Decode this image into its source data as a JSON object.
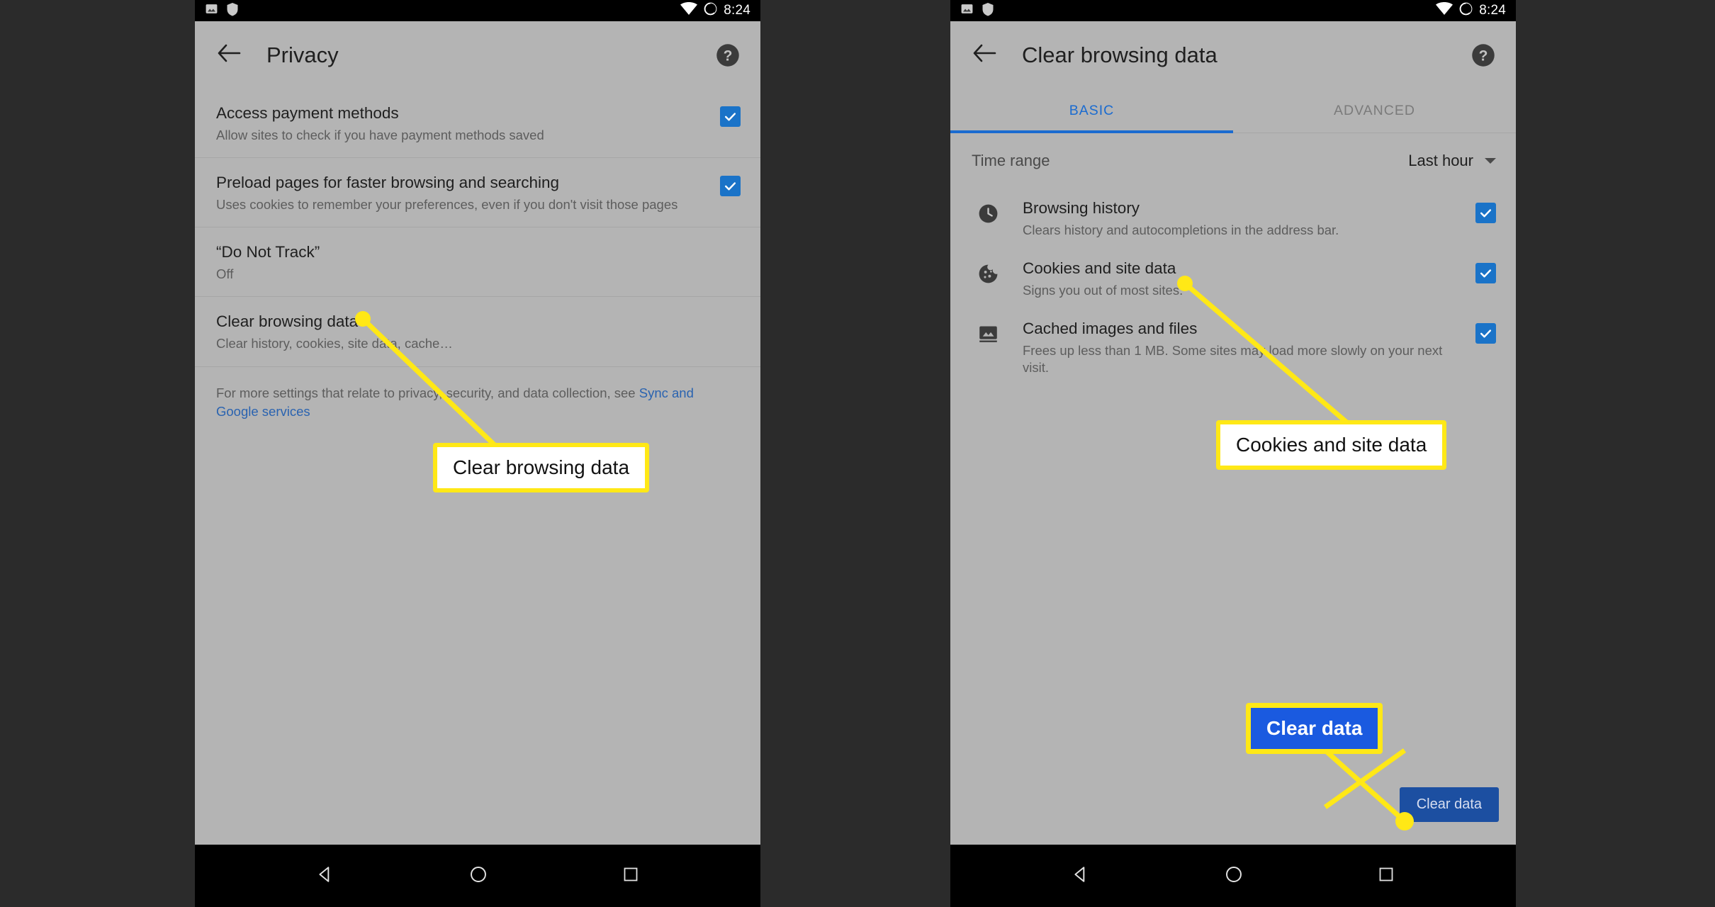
{
  "status_bar": {
    "time": "8:24",
    "icons_left": [
      "image-icon",
      "shield-icon"
    ],
    "icons_right": [
      "wifi-icon",
      "battery-icon"
    ]
  },
  "nav_bar": {
    "back": "back-triangle-icon",
    "home": "home-circle-icon",
    "recents": "recents-square-icon"
  },
  "colors": {
    "accent_blue": "#1a73c8",
    "link_blue": "#2a63b0",
    "tab_blue": "#1a6bd0",
    "highlight_yellow": "#ffe816",
    "button_blue": "#1c4fa1",
    "screen_bg": "#b4b4b4"
  },
  "left_phone": {
    "appbar": {
      "back_icon": "arrow-back-icon",
      "title": "Privacy",
      "help_icon": "help-icon"
    },
    "rows": [
      {
        "title": "Access payment methods",
        "sub": "Allow sites to check if you have payment methods saved",
        "checked": true
      },
      {
        "title": "Preload pages for faster browsing and searching",
        "sub": "Uses cookies to remember your preferences, even if you don't visit those pages",
        "checked": true
      },
      {
        "title": "“Do Not Track”",
        "sub": "Off",
        "checked": false
      },
      {
        "title": "Clear browsing data",
        "sub": "Clear history, cookies, site data, cache…",
        "checked": false
      }
    ],
    "footnote": {
      "text": "For more settings that relate to privacy, security, and data collection, see ",
      "link": "Sync and Google services"
    }
  },
  "right_phone": {
    "appbar": {
      "back_icon": "arrow-back-icon",
      "title": "Clear browsing data",
      "help_icon": "help-icon"
    },
    "tabs": [
      {
        "label": "BASIC",
        "active": true
      },
      {
        "label": "ADVANCED",
        "active": false
      }
    ],
    "time_range": {
      "label": "Time range",
      "value": "Last hour",
      "caret_icon": "chevron-down-icon"
    },
    "rows": [
      {
        "icon": "clock-icon",
        "title": "Browsing history",
        "sub": "Clears history and autocompletions in the address bar.",
        "checked": true
      },
      {
        "icon": "cookie-icon",
        "title": "Cookies and site data",
        "sub": "Signs you out of most sites.",
        "checked": true
      },
      {
        "icon": "image-icon",
        "title": "Cached images and files",
        "sub": "Frees up less than 1 MB. Some sites may load more slowly on your next visit.",
        "checked": true
      }
    ],
    "clear_button": "Clear data"
  },
  "annotations": [
    {
      "label": "Clear browsing data",
      "style": "white"
    },
    {
      "label": "Cookies and site data",
      "style": "white"
    },
    {
      "label": "Clear data",
      "style": "blue"
    }
  ]
}
